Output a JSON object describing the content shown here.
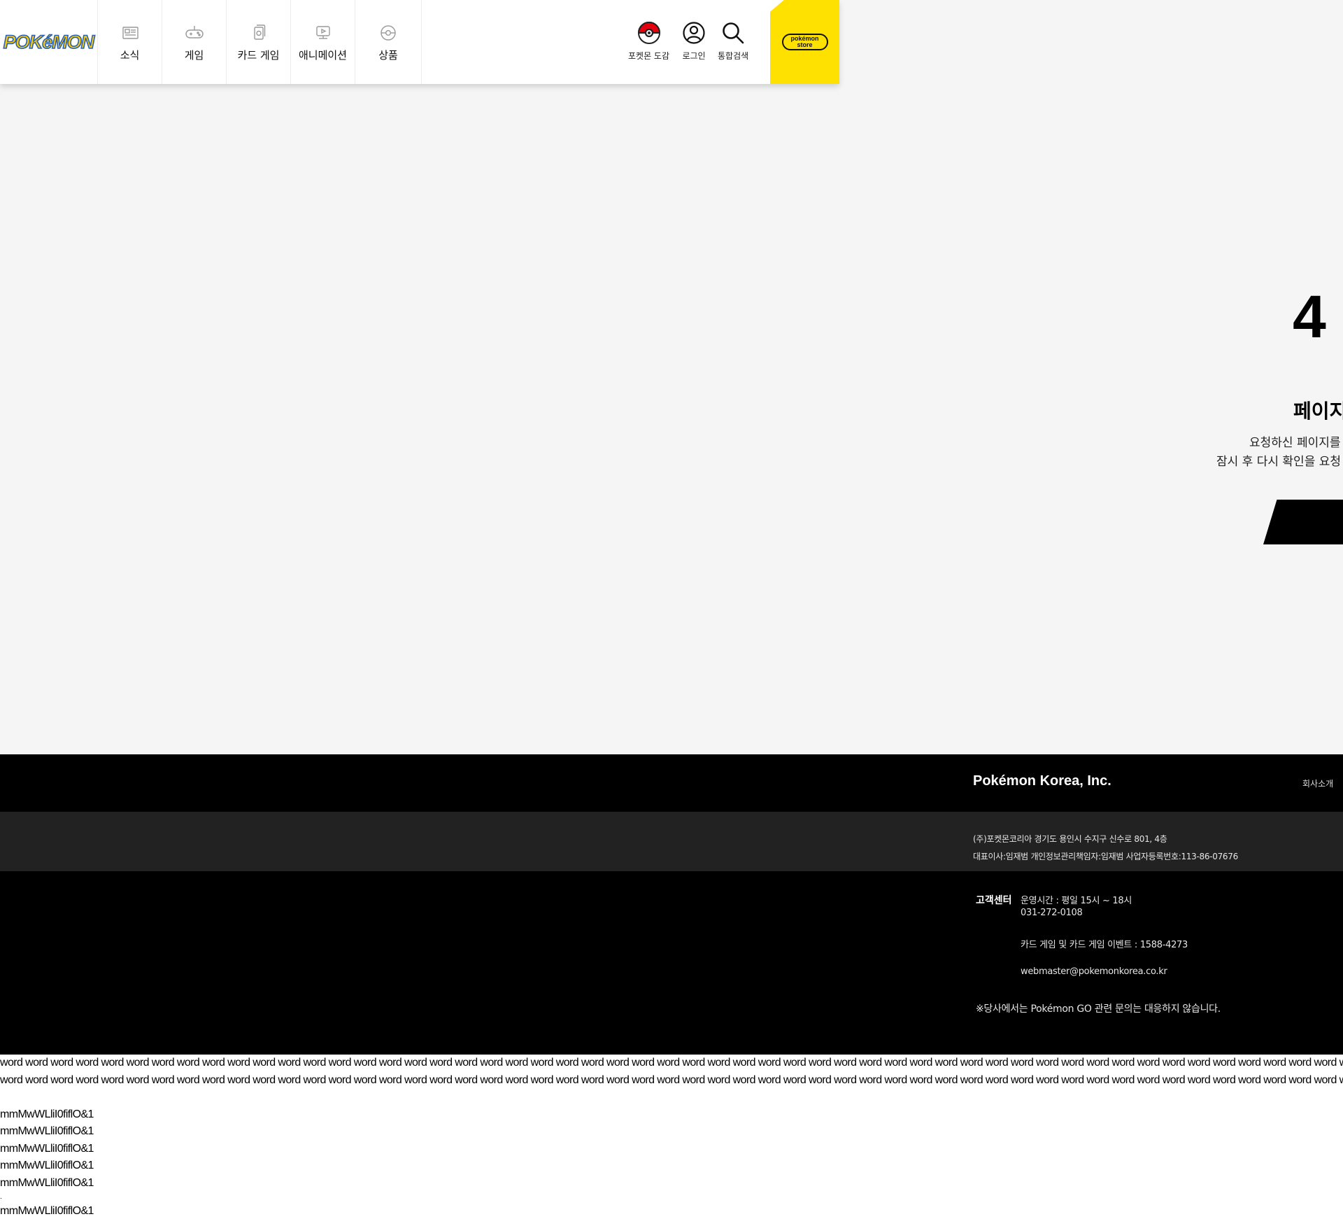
{
  "logo": {
    "text": "POKéMON"
  },
  "nav": [
    {
      "id": "news",
      "label": "소식",
      "icon": "newspaper-icon"
    },
    {
      "id": "game",
      "label": "게임",
      "icon": "gamepad-icon"
    },
    {
      "id": "card",
      "label": "카드 게임",
      "icon": "cards-icon"
    },
    {
      "id": "anime",
      "label": "애니메이션",
      "icon": "tv-icon"
    },
    {
      "id": "goods",
      "label": "상품",
      "icon": "pokeball-outline-icon"
    }
  ],
  "utilities": [
    {
      "id": "pokedex",
      "label": "포켓몬 도감",
      "icon": "pokeball-icon"
    },
    {
      "id": "login",
      "label": "로그인",
      "icon": "user-icon"
    },
    {
      "id": "search",
      "label": "통합검색",
      "icon": "search-icon"
    }
  ],
  "store": {
    "line1": "pokémon",
    "line2": "store"
  },
  "error": {
    "digit": "4",
    "title": "페이지",
    "line1": "요청하신 페이지를",
    "line2": "잠시 후 다시 확인을 요청 !"
  },
  "footer": {
    "brand": "Pokémon Korea, Inc.",
    "about": "회사소개",
    "info_line1": "(주)포켓몬코리아   경기도 용인시 수지구 신수로 801, 4층",
    "info_line2": "대표이사:임재범     개인정보관리책임자:임재범     사업자등록번호:113-86-07676",
    "cs_title": "고객센터",
    "cs_hours": "운영시간 : 평일 15시 ~ 18시",
    "cs_phone": "031-272-0108",
    "cs_card": "카드 게임 및 카드 게임 이벤트 : 1588-4273",
    "cs_email": "webmaster@pokemonkorea.co.kr",
    "note": "※당사에서는 Pokémon GO 관련 문의는 대응하지 않습니다."
  },
  "tail": {
    "word_line": "word word word word word word word word word word word word word word word word word word word word word word word word word word word word word word word word word word word word word word word word word word word word word word word word word word word word word word word word word word word word word word",
    "glyph_line": "mmMwWLliI0fiflO&1",
    "dot": "."
  },
  "colors": {
    "accent": "#ffe100",
    "footer_dark": "#000000",
    "footer_mid": "#222222",
    "page_bg": "#f5f5f5"
  }
}
